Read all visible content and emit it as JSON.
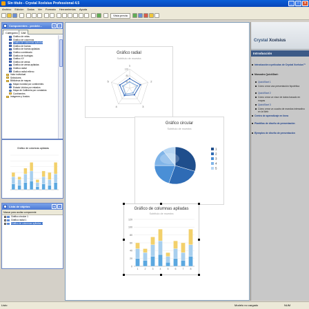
{
  "window": {
    "title": "Sin título - Crystal Xcelsius Professional 4.5",
    "buttons": [
      "minimize",
      "maximize",
      "close"
    ]
  },
  "menu": [
    "Archivo",
    "Edición",
    "Datos",
    "Ver",
    "Formato",
    "Herramientas",
    "Ayuda"
  ],
  "toolbar": {
    "preview_label": "Vista previa"
  },
  "components_panel": {
    "title": "Componentes - predete...",
    "tabs": [
      "Categoría",
      "List"
    ],
    "tree": [
      {
        "label": "Gráfico de velas",
        "indent": 2,
        "icon": "chart"
      },
      {
        "label": "Gráfico de columnas",
        "indent": 2,
        "icon": "chart"
      },
      {
        "label": "Gráfico de columnas apiladas",
        "indent": 2,
        "icon": "chart",
        "selected": true
      },
      {
        "label": "Gráfico de barras",
        "indent": 2,
        "icon": "chart"
      },
      {
        "label": "Gráfico de barras apiladas",
        "indent": 2,
        "icon": "chart"
      },
      {
        "label": "Gráfico combinado",
        "indent": 2,
        "icon": "chart"
      },
      {
        "label": "Gráfico de burbujas",
        "indent": 2,
        "icon": "chart"
      },
      {
        "label": "Gráfico XY",
        "indent": 2,
        "icon": "chart"
      },
      {
        "label": "Gráfico de áreas",
        "indent": 2,
        "icon": "chart"
      },
      {
        "label": "Gráfico de áreas apiladas",
        "indent": 2,
        "icon": "chart"
      },
      {
        "label": "Gráfico radial",
        "indent": 2,
        "icon": "chart"
      },
      {
        "label": "Gráfico radial relleno",
        "indent": 2,
        "icon": "chart"
      },
      {
        "label": "Valor individual",
        "indent": 1,
        "icon": "folder"
      },
      {
        "label": "Selectores",
        "indent": 1,
        "icon": "folder"
      },
      {
        "label": "Biblioteca de mapas",
        "indent": 1,
        "icon": "folder"
      },
      {
        "label": "Mapa mundial por continentes",
        "indent": 2,
        "icon": "globe"
      },
      {
        "label": "Estado Unidos por estados",
        "indent": 2,
        "icon": "globe"
      },
      {
        "label": "Mapa de California por condados",
        "indent": 2,
        "icon": "globe"
      },
      {
        "label": "Continentes",
        "indent": 2,
        "icon": "folder"
      },
      {
        "label": "Imágenes y fondos",
        "indent": 1,
        "icon": "folder"
      }
    ],
    "preview_title": "Gráfico de columnas apiladas"
  },
  "object_panel": {
    "title": "Lista de objetos",
    "subheader": "Marcar para ocultar componente",
    "items": [
      {
        "label": "Gráfico circular 1",
        "selected": false
      },
      {
        "label": "Gráfico radial 1",
        "selected": false
      },
      {
        "label": "Gráfico de columnas apiladas 1",
        "selected": true
      }
    ]
  },
  "canvas": {
    "radar": {
      "title": "Gráfico radial",
      "subtitle": "Subtítulo de muestra",
      "axis_labels": [
        "1",
        "2",
        "3",
        "4",
        "5"
      ],
      "scale_labels": [
        "120",
        "80",
        "40"
      ]
    },
    "pie": {
      "title": "Gráfico circular",
      "subtitle": "Subtítulo de muestra",
      "legend": [
        "1",
        "2",
        "3",
        "4",
        "5"
      ],
      "colors": [
        "#1f4e8c",
        "#2e6bb5",
        "#4a8fd6",
        "#7fb4e8",
        "#b7d6f3"
      ]
    },
    "stacked": {
      "title": "Gráfico de columnas apiladas",
      "subtitle": "Subtítulo de muestra",
      "y_ticks": [
        "120",
        "100",
        "80",
        "60",
        "40",
        "20",
        "0"
      ],
      "x_ticks": [
        "1",
        "2",
        "3",
        "4",
        "5",
        "6",
        "7",
        "8"
      ]
    }
  },
  "chart_data": [
    {
      "type": "radar",
      "title": "Gráfico radial",
      "subtitle": "Subtítulo de muestra",
      "categories": [
        "1",
        "2",
        "3",
        "4",
        "5"
      ],
      "ylim": [
        0,
        120
      ],
      "series": [
        {
          "values": [
            60,
            70,
            50,
            55,
            65
          ]
        },
        {
          "values": [
            40,
            50,
            35,
            45,
            45
          ]
        }
      ]
    },
    {
      "type": "pie",
      "title": "Gráfico circular",
      "subtitle": "Subtítulo de muestra",
      "categories": [
        "1",
        "2",
        "3",
        "4",
        "5"
      ],
      "values": [
        30,
        25,
        20,
        15,
        10
      ]
    },
    {
      "type": "bar",
      "stacked": true,
      "title": "Gráfico de columnas apiladas",
      "subtitle": "Subtítulo de muestra",
      "categories": [
        "1",
        "2",
        "3",
        "4",
        "5",
        "6",
        "7",
        "8"
      ],
      "ylim": [
        0,
        120
      ],
      "series": [
        {
          "values": [
            20,
            15,
            25,
            30,
            10,
            20,
            15,
            25
          ]
        },
        {
          "values": [
            25,
            20,
            30,
            35,
            15,
            25,
            20,
            30
          ]
        },
        {
          "values": [
            15,
            10,
            20,
            30,
            10,
            20,
            25,
            40
          ]
        }
      ],
      "colors": [
        "#5ba8e0",
        "#a8cfee",
        "#f2d06b"
      ]
    }
  ],
  "mini_preview": {
    "title": "Gráfico de columnas apiladas",
    "series": [
      {
        "values": [
          20,
          15,
          25,
          30,
          10,
          20,
          15,
          25
        ]
      },
      {
        "values": [
          25,
          20,
          30,
          35,
          15,
          25,
          20,
          30
        ]
      },
      {
        "values": [
          15,
          10,
          20,
          30,
          10,
          20,
          25,
          40
        ]
      }
    ]
  },
  "right_panel": {
    "logo_prefix": "Crystal ",
    "logo_brand": "Xcelsius",
    "section": "Introducción",
    "links": [
      {
        "label": "Introducción a películas de Crystal Xcelsius™",
        "bold": true
      },
      {
        "label": "Manuales QuickStart:",
        "bold": true,
        "plain": true
      },
      {
        "label": "QuickStart 1",
        "bold": false
      },
      {
        "label": "Cómo crear una presentación hipotética",
        "bold": false,
        "plain": true
      },
      {
        "label": "QuickStart 2",
        "bold": false
      },
      {
        "label": "Cómo crear un visor de datos basado en mapas",
        "bold": false,
        "plain": true
      },
      {
        "label": "QuickStart 3",
        "bold": false
      },
      {
        "label": "Cómo crear un cuadro de mandos interactivo en la Web",
        "bold": false,
        "plain": true
      },
      {
        "label": "Centro de aprendizaje en línea",
        "bold": true
      },
      {
        "label": "Plantillas de diseño de presentación",
        "bold": true
      },
      {
        "label": "Ejemplos de diseño de presentación",
        "bold": true
      }
    ]
  },
  "statusbar": {
    "left": "Listo",
    "model": "Modelo no cargado",
    "mode": "NUM"
  }
}
